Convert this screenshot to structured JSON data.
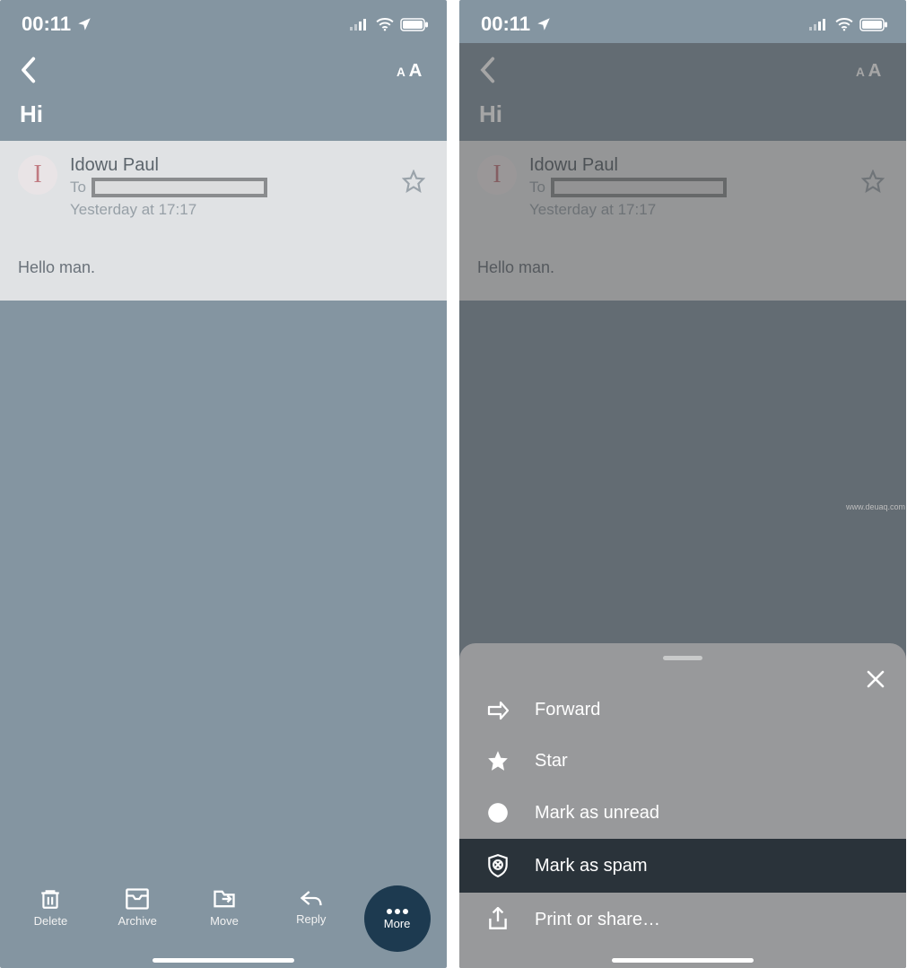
{
  "status": {
    "time": "00:11"
  },
  "header": {
    "subject": "Hi"
  },
  "message": {
    "avatar_initial": "I",
    "sender": "Idowu Paul",
    "to_label": "To",
    "date": "Yesterday at 17:17",
    "body": "Hello man."
  },
  "toolbar": {
    "delete": "Delete",
    "archive": "Archive",
    "move": "Move",
    "reply": "Reply",
    "more": "More"
  },
  "sheet": {
    "forward": "Forward",
    "star": "Star",
    "mark_unread": "Mark as unread",
    "mark_spam": "Mark as spam",
    "print_share": "Print or share…"
  },
  "watermark": "www.deuaq.com"
}
